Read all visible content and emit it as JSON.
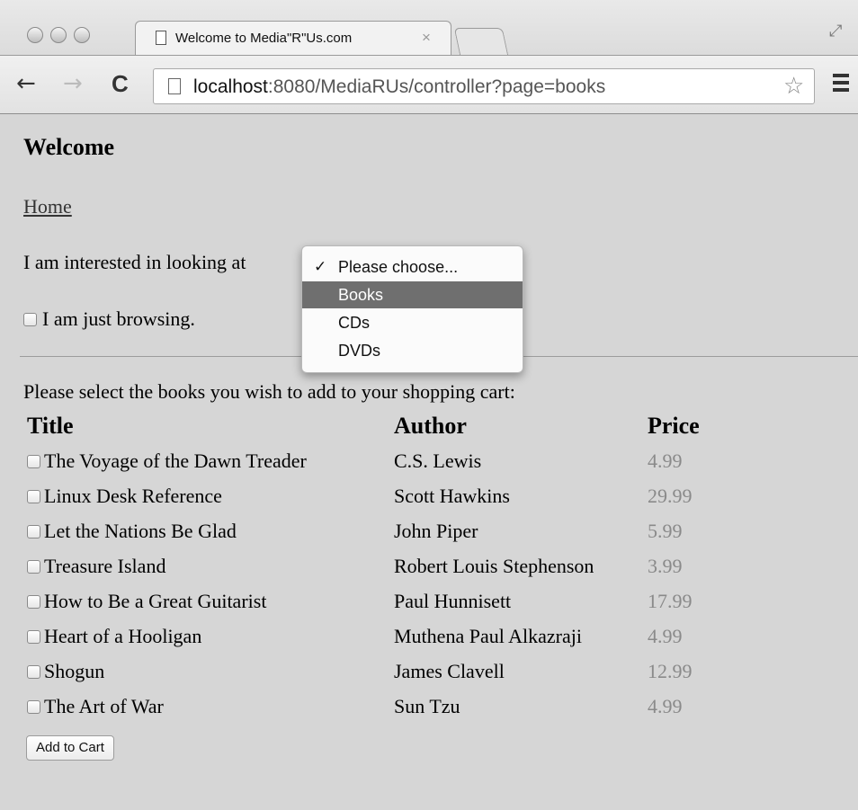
{
  "browser": {
    "tab_title": "Welcome to Media\"R\"Us.com",
    "tab_close": "×",
    "url_host": "localhost",
    "url_rest": ":8080/MediaRUs/controller?page=books",
    "nav_back": "←",
    "nav_forward": "→",
    "nav_reload": "C",
    "star": "☆",
    "resize": "⤢"
  },
  "page": {
    "heading": "Welcome",
    "home_link": "Home",
    "interest_label": "I am interested in looking at",
    "browsing_label": "I am just browsing.",
    "select_prompt": "Please select the books you wish to add to your shopping cart:",
    "add_button": "Add to Cart"
  },
  "dropdown": {
    "check_mark": "✓",
    "options": [
      {
        "label": "Please choose...",
        "checked": true,
        "highlighted": false
      },
      {
        "label": "Books",
        "checked": false,
        "highlighted": true
      },
      {
        "label": "CDs",
        "checked": false,
        "highlighted": false
      },
      {
        "label": "DVDs",
        "checked": false,
        "highlighted": false
      }
    ]
  },
  "table": {
    "headers": {
      "title": "Title",
      "author": "Author",
      "price": "Price"
    },
    "rows": [
      {
        "title": "The Voyage of the Dawn Treader",
        "author": "C.S. Lewis",
        "price": "4.99"
      },
      {
        "title": "Linux Desk Reference",
        "author": "Scott Hawkins",
        "price": "29.99"
      },
      {
        "title": "Let the Nations Be Glad",
        "author": "John Piper",
        "price": "5.99"
      },
      {
        "title": "Treasure Island",
        "author": "Robert Louis Stephenson",
        "price": "3.99"
      },
      {
        "title": "How to Be a Great Guitarist",
        "author": "Paul Hunnisett",
        "price": "17.99"
      },
      {
        "title": "Heart of a Hooligan",
        "author": "Muthena Paul Alkazraji",
        "price": "4.99"
      },
      {
        "title": "Shogun",
        "author": "James Clavell",
        "price": "12.99"
      },
      {
        "title": "The Art of War",
        "author": "Sun Tzu",
        "price": "4.99"
      }
    ]
  }
}
